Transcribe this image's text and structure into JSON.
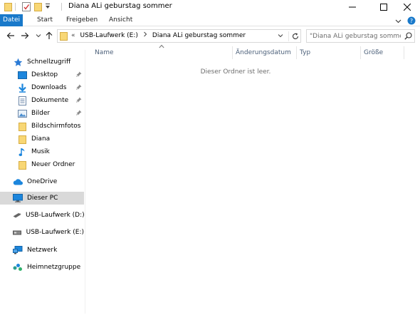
{
  "window": {
    "title": "Diana ALi geburstag sommer",
    "controls": {
      "minimize": "minimize",
      "maximize": "maximize",
      "close": "close"
    }
  },
  "ribbon": {
    "tabs": [
      {
        "label": "Datei",
        "active": true
      },
      {
        "label": "Start"
      },
      {
        "label": "Freigeben"
      },
      {
        "label": "Ansicht"
      }
    ]
  },
  "navigation": {
    "breadcrumb_prefix": "«",
    "path": [
      "USB-Laufwerk (E:)",
      "Diana ALi geburstag sommer"
    ],
    "search_placeholder": "\"Diana ALi geburstag sommer...\""
  },
  "sidebar": {
    "quick_access": {
      "label": "Schnellzugriff",
      "items": [
        {
          "label": "Desktop",
          "icon": "desktop-icon",
          "pinned": true
        },
        {
          "label": "Downloads",
          "icon": "download-icon",
          "pinned": true
        },
        {
          "label": "Dokumente",
          "icon": "documents-icon",
          "pinned": true
        },
        {
          "label": "Bilder",
          "icon": "pictures-icon",
          "pinned": true
        },
        {
          "label": "Bildschirmfotos",
          "icon": "folder-icon",
          "pinned": false
        },
        {
          "label": "Diana",
          "icon": "folder-icon",
          "pinned": false
        },
        {
          "label": "Musik",
          "icon": "music-icon",
          "pinned": false
        },
        {
          "label": "Neuer Ordner",
          "icon": "folder-icon",
          "pinned": false
        }
      ]
    },
    "onedrive": "OneDrive",
    "this_pc": "Dieser PC",
    "drives": [
      "USB-Laufwerk (D:)",
      "USB-Laufwerk (E:)"
    ],
    "network": "Netzwerk",
    "homegroup": "Heimnetzgruppe"
  },
  "content": {
    "columns": [
      "Name",
      "Änderungsdatum",
      "Typ",
      "Größe"
    ],
    "empty_message": "Dieser Ordner ist leer."
  },
  "colors": {
    "accent": "#1979ca",
    "selected": "#cce8ff",
    "folder": "#f8d775",
    "column_header_text": "#4c607a"
  }
}
